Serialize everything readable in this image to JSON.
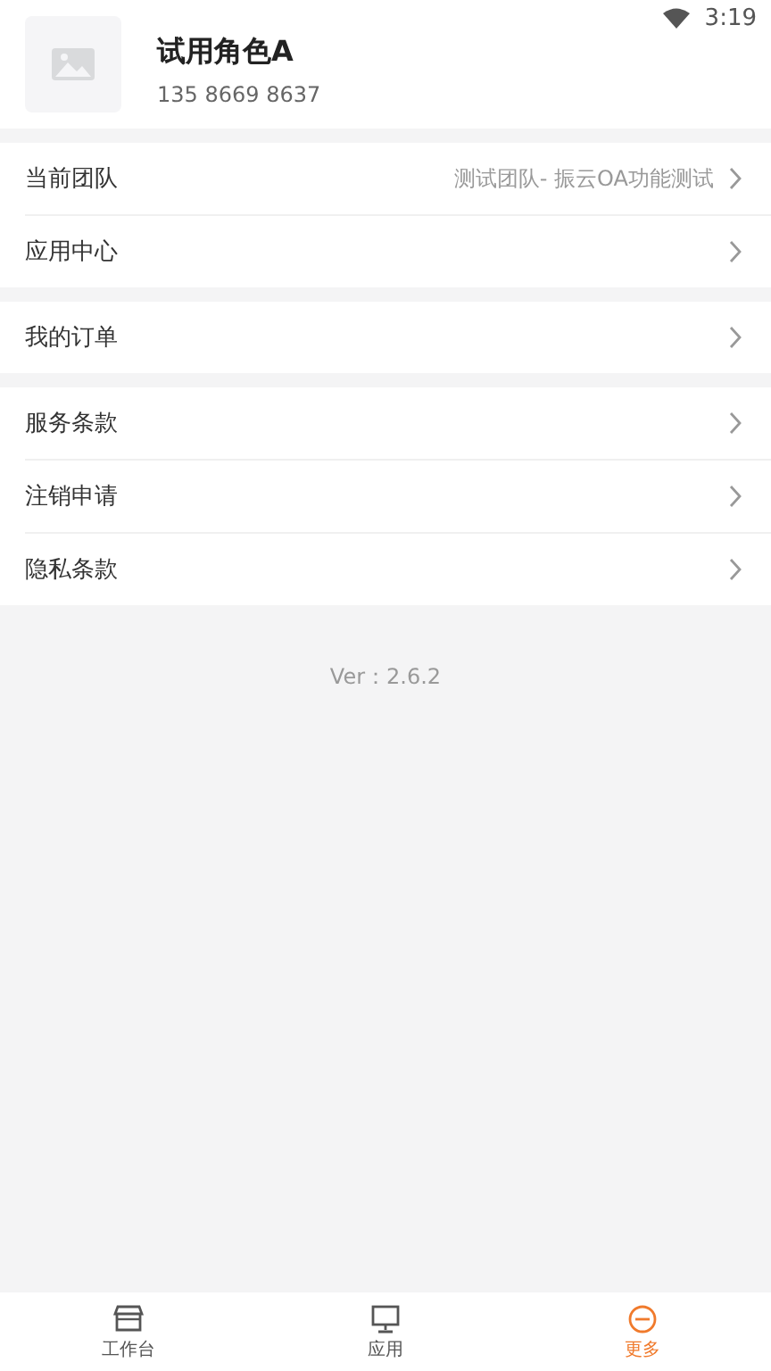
{
  "status_bar": {
    "time": "3:19"
  },
  "profile": {
    "name": "试用角色A",
    "phone": "135 8669 8637"
  },
  "groups": [
    {
      "items": [
        {
          "label": "当前团队",
          "value": "测试团队- 振云OA功能测试"
        },
        {
          "label": "应用中心"
        }
      ]
    },
    {
      "items": [
        {
          "label": "我的订单"
        }
      ]
    },
    {
      "items": [
        {
          "label": "服务条款"
        },
        {
          "label": "注销申请"
        },
        {
          "label": "隐私条款"
        }
      ]
    }
  ],
  "version": "Ver：2.6.2",
  "tabs": [
    {
      "label": "工作台",
      "selected": false
    },
    {
      "label": "应用",
      "selected": false
    },
    {
      "label": "更多",
      "selected": true
    }
  ]
}
